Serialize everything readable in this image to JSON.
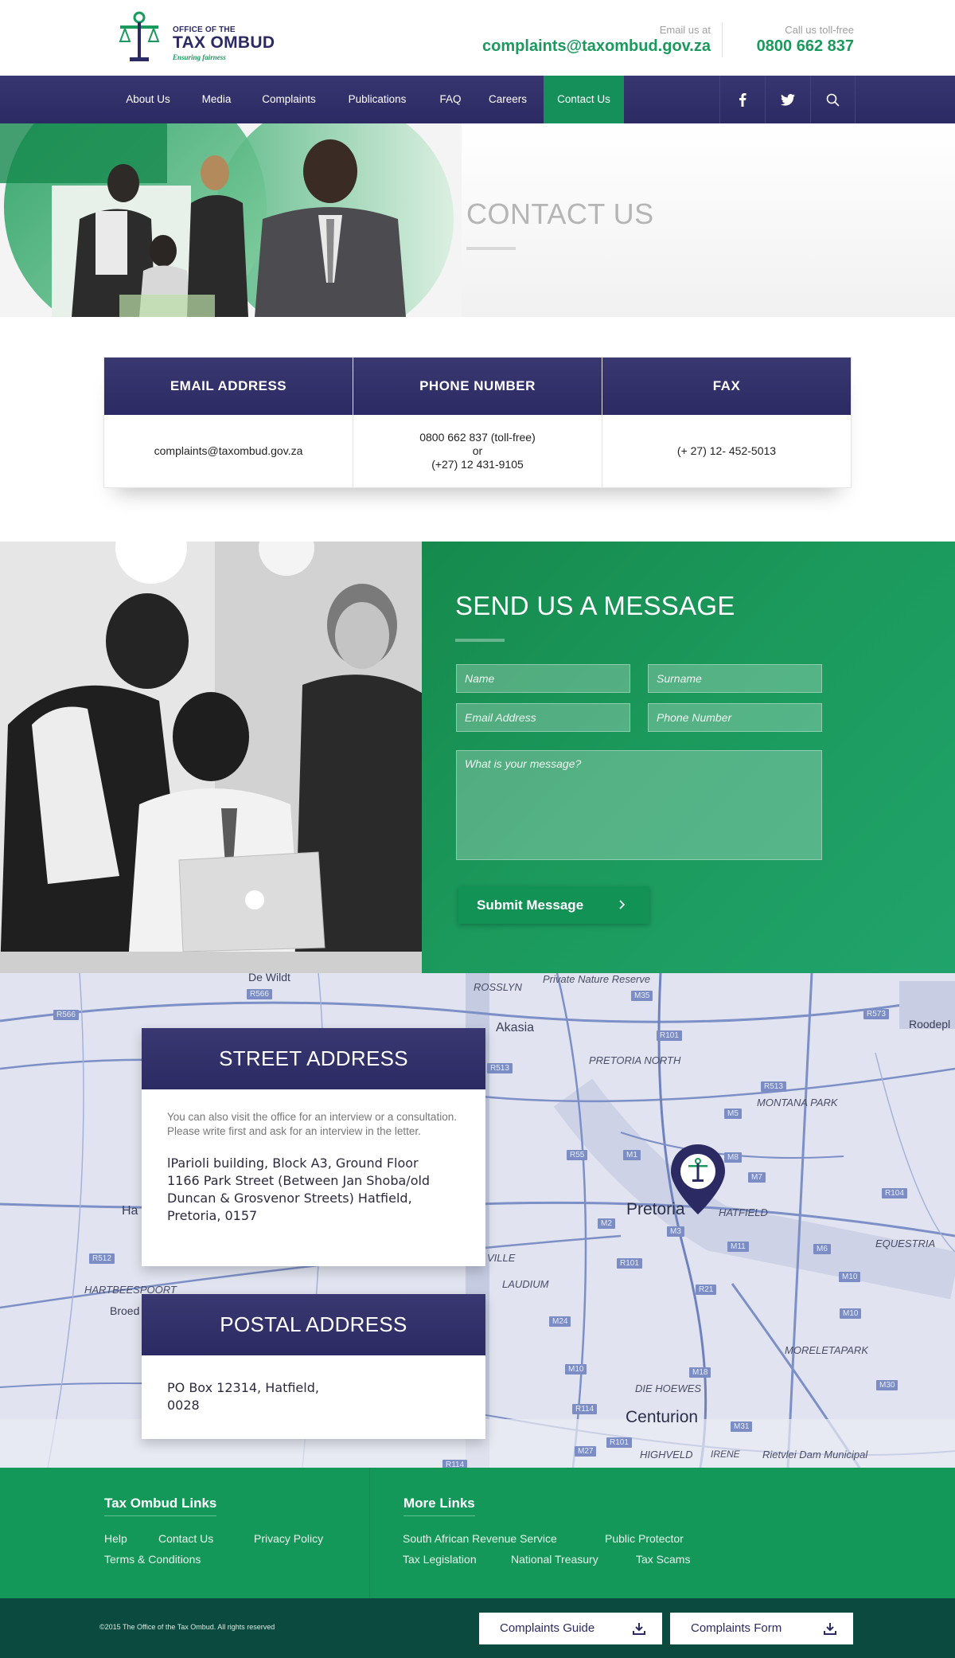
{
  "header": {
    "logo_small": "OFFICE OF THE",
    "logo_big": "TAX OMBUD",
    "logo_tagline": "Ensuring fairness",
    "email_label": "Email us at",
    "email_value": "complaints@taxombud.gov.za",
    "phone_label": "Call us toll-free",
    "phone_value": "0800 662 837"
  },
  "nav": {
    "items": [
      "About Us",
      "Media",
      "Complaints",
      "Publications",
      "FAQ",
      "Careers",
      "Contact Us"
    ],
    "active": "Contact Us",
    "social": [
      "facebook-icon",
      "twitter-icon",
      "search-icon"
    ]
  },
  "hero": {
    "title": "CONTACT US"
  },
  "contact_table": {
    "columns": [
      {
        "heading": "EMAIL ADDRESS",
        "lines": [
          "complaints@taxombud.gov.za"
        ]
      },
      {
        "heading": "PHONE NUMBER",
        "lines": [
          "0800 662 837 (toll-free)",
          "or",
          "(+27) 12 431-9105"
        ]
      },
      {
        "heading": "FAX",
        "lines": [
          "(+ 27) 12- 452-5013"
        ]
      }
    ]
  },
  "message_form": {
    "title": "SEND US A MESSAGE",
    "name_placeholder": "Name",
    "surname_placeholder": "Surname",
    "email_placeholder": "Email Address",
    "phone_placeholder": "Phone Number",
    "message_placeholder": "What is your message?",
    "submit_label": "Submit Message"
  },
  "map": {
    "labels": [
      "De Wildt",
      "ROSSLYN",
      "Private Nature Reserve",
      "Akasia",
      "PRETORIA NORTH",
      "MONTANA PARK",
      "Roodepl",
      "Pretoria",
      "HATFIELD",
      "EQUESTRIA",
      "Ha",
      "VILLE",
      "LAUDIUM",
      "HARTBEESPOORT",
      "Broed",
      "MORELETAPARK",
      "DIE HOEWES",
      "Centurion",
      "HIGHVELD",
      "IRENE",
      "Rietvlei Dam Municipal"
    ],
    "roads": [
      "R566",
      "R566",
      "M35",
      "R573",
      "R101",
      "R513",
      "R513",
      "M5",
      "M1",
      "R55",
      "M8",
      "M7",
      "R104",
      "M2",
      "M3",
      "M11",
      "M6",
      "R101",
      "R21",
      "M10",
      "M24",
      "R512",
      "M10",
      "M18",
      "R114",
      "M10",
      "M31",
      "M30",
      "R101",
      "R114",
      "M27"
    ]
  },
  "street_address": {
    "title": "STREET ADDRESS",
    "note": "You can also visit the office for an interview or a consultation. Please write first and ask for an interview in the letter.",
    "lines": [
      "lParioli building, Block A3, Ground Floor",
      "1166 Park Street (Between Jan Shoba/old",
      "Duncan & Grosvenor Streets) Hatfield,",
      "Pretoria, 0157"
    ]
  },
  "postal_address": {
    "title": "POSTAL ADDRESS",
    "lines": [
      "PO Box 12314, Hatfield,",
      "0028"
    ]
  },
  "footer": {
    "left_heading": "Tax Ombud Links",
    "left_links": [
      "Help",
      "Contact Us",
      "Privacy Policy",
      "Terms & Conditions"
    ],
    "right_heading": "More Links",
    "right_links": [
      "South African Revenue Service",
      "Public Protector",
      "Tax Legislation",
      "National Treasury",
      "Tax Scams"
    ]
  },
  "bottom_bar": {
    "copyright": "©2015 The Office of the Tax Ombud. All rights reserved",
    "guide_button": "Complaints Guide",
    "form_button": "Complaints Form"
  },
  "colors": {
    "brand_purple": "#2c2a63",
    "brand_green": "#1a9a5c",
    "footer_dark": "#0b4a3f"
  }
}
